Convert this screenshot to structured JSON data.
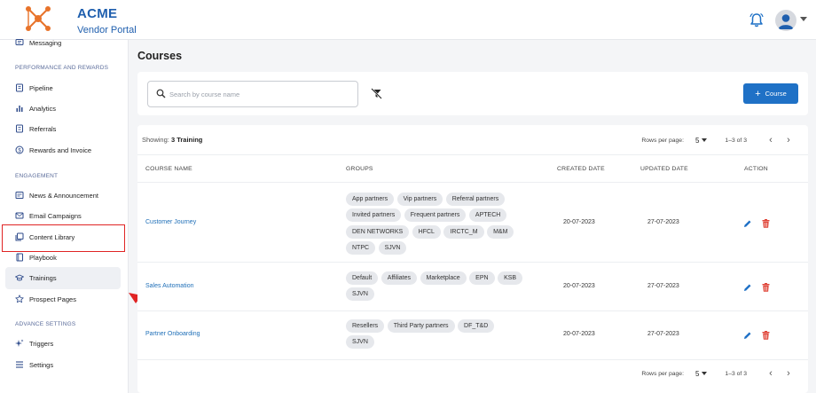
{
  "app": {
    "brand_name": "ACME",
    "brand_subtitle": "Vendor Portal",
    "accent_color": "#1f71c6"
  },
  "header": {
    "notification_icon": "bell-icon",
    "avatar_icon": "user-avatar-icon"
  },
  "sidebar": {
    "partial_item": {
      "label": "Messaging",
      "icon": "message-icon"
    },
    "sections": [
      {
        "title": "PERFORMANCE AND REWARDS",
        "items": [
          {
            "label": "Pipeline",
            "icon": "pipeline-icon"
          },
          {
            "label": "Analytics",
            "icon": "bar-chart-icon"
          },
          {
            "label": "Referrals",
            "icon": "referrals-icon"
          },
          {
            "label": "Rewards and Invoice",
            "icon": "dollar-icon"
          }
        ]
      },
      {
        "title": "ENGAGEMENT",
        "items": [
          {
            "label": "News & Announcement",
            "icon": "news-icon"
          },
          {
            "label": "Email Campaigns",
            "icon": "email-icon"
          },
          {
            "label": "Content Library",
            "icon": "library-icon"
          },
          {
            "label": "Playbook",
            "icon": "book-icon"
          },
          {
            "label": "Trainings",
            "icon": "graduation-cap-icon",
            "active": true
          },
          {
            "label": "Prospect Pages",
            "icon": "star-icon"
          }
        ]
      },
      {
        "title": "ADVANCE SETTINGS",
        "items": [
          {
            "label": "Triggers",
            "icon": "sparkle-icon"
          },
          {
            "label": "Settings",
            "icon": "settings-list-icon"
          }
        ]
      }
    ]
  },
  "main": {
    "title": "Courses",
    "search": {
      "placeholder": "Search by course name",
      "value": ""
    },
    "add_button_label": "Course",
    "showing_prefix": "Showing:",
    "showing_count": "3 Training",
    "pagination": {
      "rows_per_page_label": "Rows per page:",
      "rows_per_page": "5",
      "range": "1–3 of 3"
    },
    "columns": [
      "COURSE NAME",
      "GROUPS",
      "CREATED DATE",
      "UPDATED DATE",
      "ACTION"
    ],
    "rows": [
      {
        "name": "Customer Journey",
        "groups": [
          "App partners",
          "Vip partners",
          "Referral partners",
          "Invited partners",
          "Frequent partners",
          "APTECH",
          "DEN NETWORKS",
          "HFCL",
          "IRCTC_M",
          "M&M",
          "NTPC",
          "SJVN"
        ],
        "created": "20-07-2023",
        "updated": "27-07-2023"
      },
      {
        "name": "Sales Automation",
        "groups": [
          "Default",
          "Affiliates",
          "Marketplace",
          "EPN",
          "KSB",
          "SJVN"
        ],
        "created": "20-07-2023",
        "updated": "27-07-2023"
      },
      {
        "name": "Partner Onboarding",
        "groups": [
          "Resellers",
          "Third Party partners",
          "DF_T&D",
          "SJVN"
        ],
        "created": "20-07-2023",
        "updated": "27-07-2023"
      }
    ]
  },
  "annotation": {
    "color": "#e02424"
  }
}
